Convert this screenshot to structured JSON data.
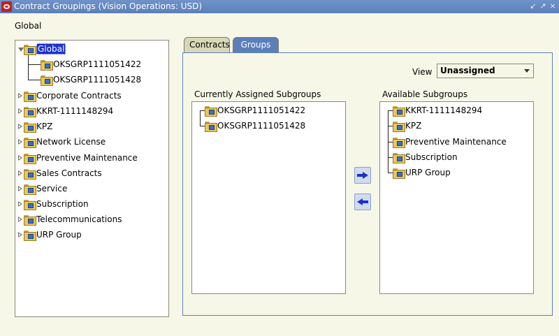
{
  "window": {
    "title": "Contract Groupings (Vision Operations: USD)",
    "buttons": [
      "↙",
      "↗",
      "×"
    ]
  },
  "breadcrumb": "Global",
  "tree": {
    "root": "Global",
    "root_children": [
      "OKSGRP1111051422",
      "OKSGRP1111051428"
    ],
    "items": [
      "Corporate Contracts",
      "KKRT-1111148294",
      "KPZ",
      "Network License",
      "Preventive Maintenance",
      "Sales Contracts",
      "Service",
      "Subscription",
      "Telecommunications",
      "URP Group"
    ]
  },
  "tabs": [
    {
      "label": "Contracts",
      "active": false
    },
    {
      "label": "Groups",
      "active": true
    }
  ],
  "view": {
    "label": "View",
    "selected": "Unassigned"
  },
  "assigned": {
    "label": "Currently Assigned Subgroups",
    "items": [
      "OKSGRP1111051422",
      "OKSGRP1111051428"
    ]
  },
  "available": {
    "label": "Available Subgroups",
    "items": [
      "KKRT-1111148294",
      "KPZ",
      "Preventive Maintenance",
      "Subscription",
      "URP Group"
    ]
  },
  "icons": {
    "folder": "folder-group-icon",
    "expand": "expand-arrow-icon",
    "move_right": "arrow-right-icon",
    "move_left": "arrow-left-icon"
  },
  "colors": {
    "background": "#f7f7e7",
    "title_bar": "#5b7fb9",
    "selection": "#1c2fd1",
    "tab_inactive": "#d8d8b8"
  }
}
